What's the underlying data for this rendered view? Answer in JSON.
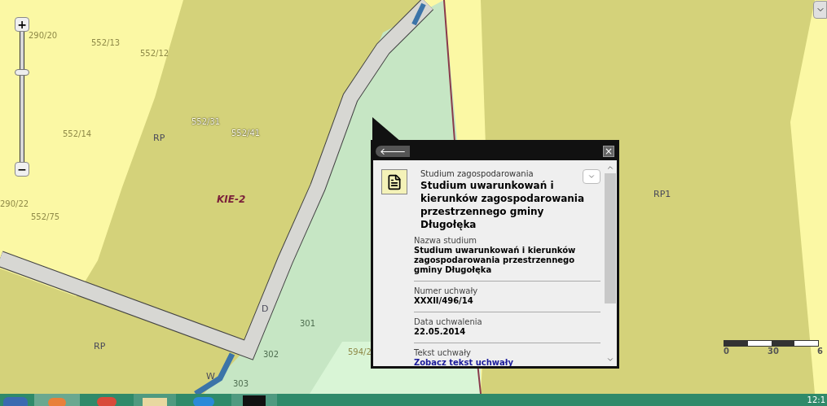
{
  "map": {
    "zoom_control": {
      "plus": "+",
      "minus": "−",
      "level": 0.7
    },
    "labels": [
      {
        "text": "RP",
        "kind": "zone"
      },
      {
        "text": "KIE-2",
        "kind": "area"
      },
      {
        "text": "D",
        "kind": "zone"
      },
      {
        "text": "RP",
        "kind": "zone"
      },
      {
        "text": "W",
        "kind": "zone"
      },
      {
        "text": "RP1",
        "kind": "zone"
      },
      {
        "text": "290/20",
        "kind": "faint"
      },
      {
        "text": "552/13",
        "kind": "faint"
      },
      {
        "text": "552/12",
        "kind": "faint"
      },
      {
        "text": "552/14",
        "kind": "faint"
      },
      {
        "text": "290/22",
        "kind": "faint"
      },
      {
        "text": "552/75",
        "kind": "faint"
      },
      {
        "text": "594/2",
        "kind": "faint"
      },
      {
        "text": "552/31",
        "kind": "parcel"
      },
      {
        "text": "552/41",
        "kind": "parcel"
      },
      {
        "text": "301",
        "kind": "plot"
      },
      {
        "text": "302",
        "kind": "plot"
      },
      {
        "text": "303",
        "kind": "plot"
      }
    ],
    "scale_bar": {
      "ticks": [
        "0",
        "30",
        "6"
      ]
    }
  },
  "popup": {
    "back": "🡐",
    "close": "×",
    "category": "Studium zagospodarowania",
    "title": "Studium uwarunkowań i kierunków zagospodarowania przestrzennego gminy Długołęka",
    "fields": [
      {
        "label": "Nazwa studium",
        "value": "Studium uwarunkowań i kierunków zagospodarowania przestrzennego gminy Długołęka",
        "kind": "text"
      },
      {
        "label": "Numer uchwały",
        "value": "XXXII/496/14",
        "kind": "text"
      },
      {
        "label": "Data uchwalenia",
        "value": "22.05.2014",
        "kind": "text"
      },
      {
        "label": "Tekst uchwały",
        "value": "Zobacz tekst uchwały",
        "kind": "link"
      }
    ]
  },
  "taskbar": {
    "clock": "12:1"
  }
}
